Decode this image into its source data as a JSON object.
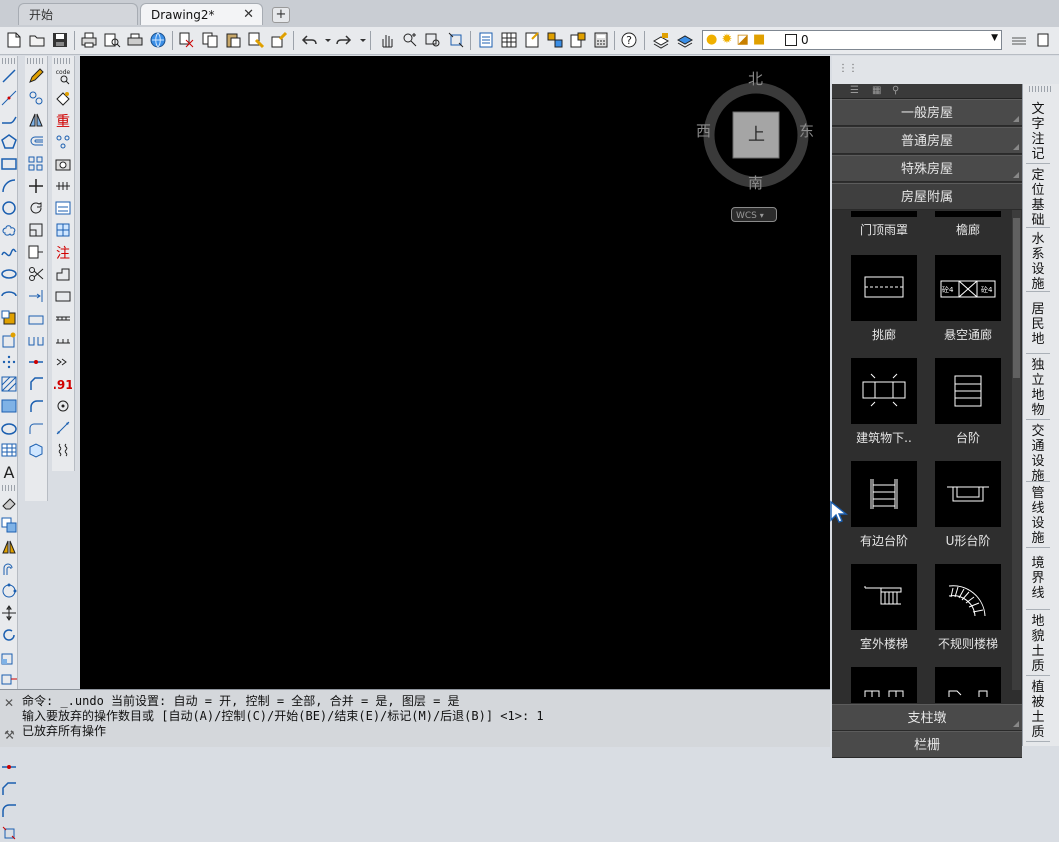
{
  "tabs": {
    "start": "开始",
    "drawing": "Drawing2*",
    "close_symbol": "✕",
    "add_symbol": "+"
  },
  "toolbar": {
    "icons": [
      "new-icon",
      "open-icon",
      "save-icon",
      "print-icon",
      "print-preview-icon",
      "plot-icon",
      "publish-icon",
      "cut-icon",
      "copy-icon",
      "paste-icon",
      "match-properties-icon",
      "block-editor-icon",
      "undo-icon",
      "redo-icon",
      "pan-icon",
      "zoom-realtime-icon",
      "zoom-window-icon",
      "zoom-previous-icon",
      "properties-icon",
      "design-center-icon",
      "tool-palettes-icon",
      "sheet-set-icon",
      "markup-icon",
      "calculator-icon",
      "help-icon",
      "layer-manager-icon",
      "layer-states-icon"
    ],
    "layer_value": "0"
  },
  "canvas": {
    "compass": {
      "north": "北",
      "south": "南",
      "east": "东",
      "west": "西",
      "top": "上"
    },
    "wcs": "WCS"
  },
  "command": {
    "line1": "命令: _.undo 当前设置: 自动 = 开, 控制 = 全部, 合并 = 是, 图层 = 是",
    "line2": "输入要放弃的操作数目或 [自动(A)/控制(C)/开始(BE)/结束(E)/标记(M)/后退(B)] <1>: 1",
    "line3": "已放弃所有操作"
  },
  "palette": {
    "categories": [
      "一般房屋",
      "普通房屋",
      "特殊房屋",
      "房屋附属"
    ],
    "partial_top_labels": [
      "门顶雨罩",
      "檐廊"
    ],
    "items": [
      "挑廊",
      "悬空通廊",
      "建筑物下..",
      "台阶",
      "有边台阶",
      "U形台阶",
      "室外楼梯",
      "不规则楼梯"
    ],
    "bottom_categories": [
      "支柱墩",
      "栏栅"
    ],
    "side_tabs": [
      "文字注记",
      "定位基础",
      "水系设施",
      "居民地",
      "独立地物",
      "交通设施",
      "管线设施",
      "境界线",
      "地貌土质",
      "植被土质"
    ]
  }
}
